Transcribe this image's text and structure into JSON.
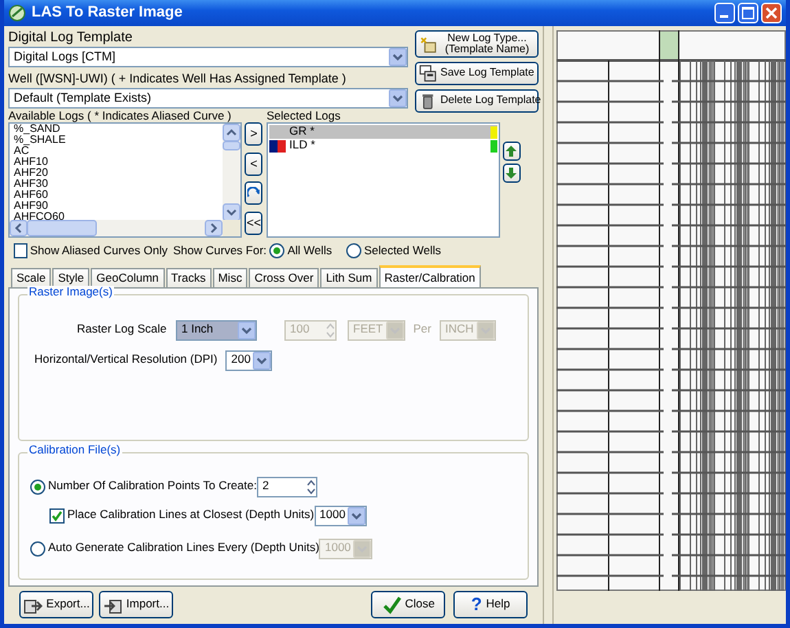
{
  "window": {
    "title": "LAS To Raster Image"
  },
  "template": {
    "label": "Digital Log Template",
    "value": "Digital Logs [CTM]"
  },
  "well": {
    "label": "Well ([WSN]-UWI) ( + Indicates Well Has Assigned Template )",
    "value": "Default (Template Exists)"
  },
  "template_buttons": [
    {
      "kind": "new",
      "lines": [
        "New Log Type...",
        "(Template Name)"
      ]
    },
    {
      "kind": "save",
      "lines": [
        "Save Log Template"
      ]
    },
    {
      "kind": "delete",
      "lines": [
        "Delete Log Template"
      ]
    }
  ],
  "available_logs": {
    "label": "Available Logs  ( * Indicates Aliased Curve )",
    "items": [
      "%_SAND",
      "%_SHALE",
      "AC",
      "AHF10",
      "AHF20",
      "AHF30",
      "AHF60",
      "AHF90",
      "AHFCO60"
    ]
  },
  "transfer_buttons": [
    {
      "kind": "text",
      "label": ">"
    },
    {
      "kind": "text",
      "label": "<"
    },
    {
      "kind": "redo"
    },
    {
      "kind": "text",
      "label": "<<"
    }
  ],
  "selected_logs": {
    "label": "Selected Logs",
    "items": [
      {
        "name": "GR *",
        "selected": true,
        "color": "#f0f000",
        "swatch": false
      },
      {
        "name": "ILD *",
        "selected": false,
        "color": "#20d020",
        "swatch": true
      }
    ]
  },
  "show_aliased_only": {
    "label": "Show Aliased Curves Only",
    "checked": false
  },
  "show_curves_for": {
    "label": "Show Curves For:",
    "options": [
      {
        "label": "All Wells",
        "selected": true
      },
      {
        "label": "Selected Wells",
        "selected": false
      }
    ]
  },
  "tabs": [
    {
      "label": "Scale",
      "selected": false
    },
    {
      "label": "Style",
      "selected": false
    },
    {
      "label": "GeoColumn",
      "selected": false
    },
    {
      "label": "Tracks",
      "selected": false
    },
    {
      "label": "Misc",
      "selected": false
    },
    {
      "label": "Cross Over",
      "selected": false
    },
    {
      "label": "Lith Sum",
      "selected": false
    },
    {
      "label": "Raster/Calbration",
      "selected": true
    }
  ],
  "raster_group": {
    "title": "Raster Image(s)",
    "scale_label": "Raster Log Scale",
    "scale_value": "1 Inch",
    "amount": "100",
    "unit": "FEET",
    "per_label": "Per",
    "per_unit": "INCH",
    "fixed_disabled": true,
    "resolution_label": "Horizontal/Vertical Resolution (DPI)",
    "resolution_value": "200"
  },
  "calibration_group": {
    "title": "Calibration File(s)",
    "options": [
      {
        "kind": "count",
        "label": "Number Of Calibration Points To Create:",
        "selected": true,
        "value": "2"
      },
      {
        "kind": "every",
        "label": "Auto Generate Calibration Lines Every (Depth Units)",
        "selected": false,
        "value": "1000"
      }
    ],
    "closest": {
      "label": "Place Calibration Lines at Closest (Depth Units)",
      "checked": true,
      "value": "1000"
    }
  },
  "footer_buttons": [
    {
      "kind": "export",
      "label": "Export..."
    },
    {
      "kind": "import",
      "label": "Import..."
    },
    {
      "kind": "close",
      "label": "Close"
    },
    {
      "kind": "help",
      "label": "Help",
      "icon": "?"
    }
  ]
}
